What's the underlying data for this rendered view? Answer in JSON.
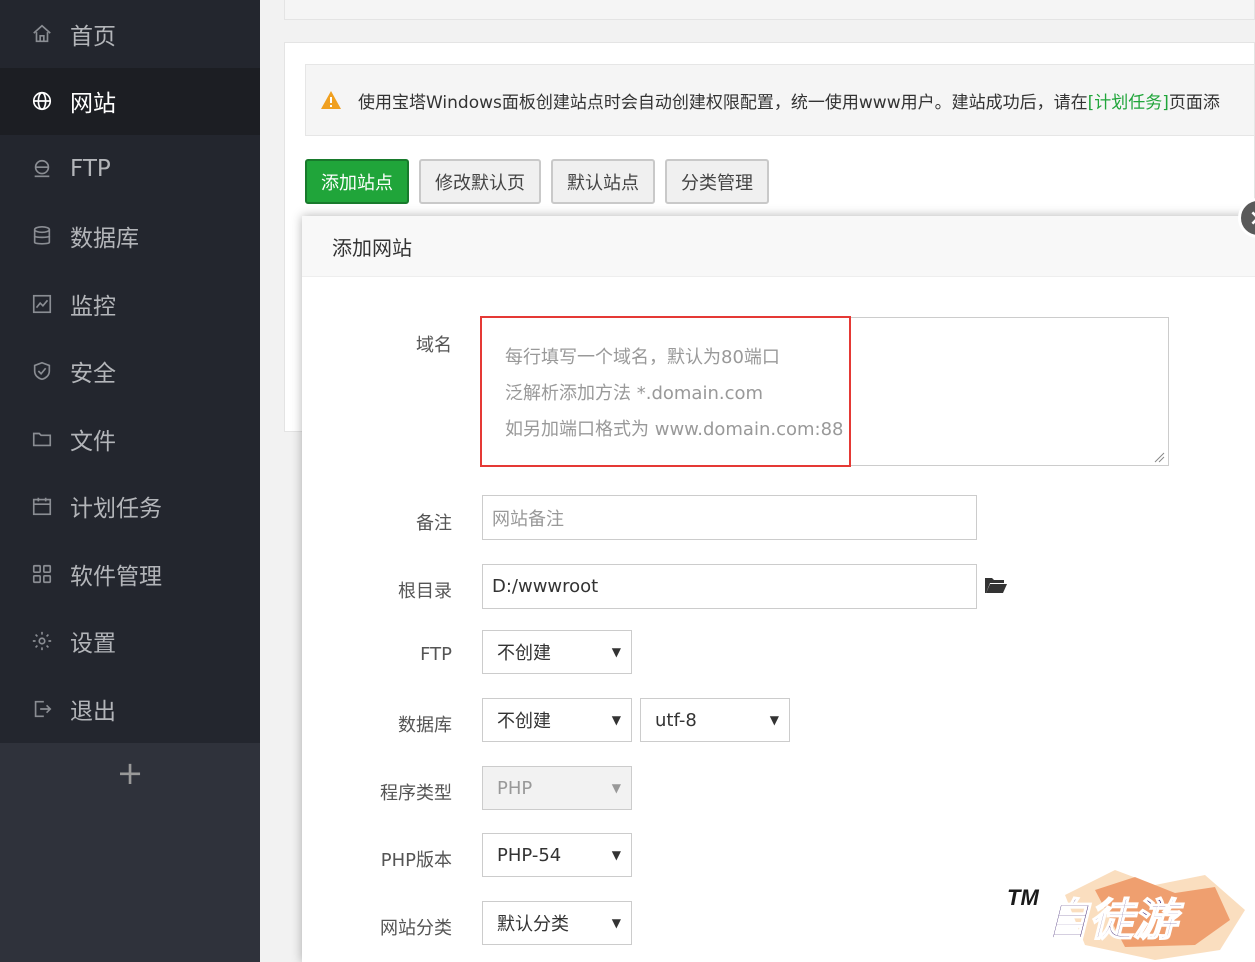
{
  "sidebar": {
    "items": [
      {
        "label": "首页",
        "icon": "home-icon"
      },
      {
        "label": "网站",
        "icon": "globe-icon",
        "active": true
      },
      {
        "label": "FTP",
        "icon": "ftp-icon"
      },
      {
        "label": "数据库",
        "icon": "database-icon"
      },
      {
        "label": "监控",
        "icon": "monitor-icon"
      },
      {
        "label": "安全",
        "icon": "shield-icon"
      },
      {
        "label": "文件",
        "icon": "folder-icon"
      },
      {
        "label": "计划任务",
        "icon": "calendar-icon"
      },
      {
        "label": "软件管理",
        "icon": "grid-icon"
      },
      {
        "label": "设置",
        "icon": "gear-icon"
      },
      {
        "label": "退出",
        "icon": "logout-icon"
      }
    ],
    "add_label": "+"
  },
  "alert": {
    "text_before": "使用宝塔Windows面板创建站点时会自动创建权限配置，统一使用www用户。建站成功后，请在",
    "link": "[计划任务]",
    "text_after": "页面添"
  },
  "toolbar": {
    "add_site": "添加站点",
    "edit_default_page": "修改默认页",
    "default_site": "默认站点",
    "category_manage": "分类管理"
  },
  "modal": {
    "title": "添加网站",
    "close": "×",
    "domain": {
      "label": "域名",
      "placeholder_lines": [
        "每行填写一个域名，默认为80端口",
        "泛解析添加方法 *.domain.com",
        "如另加端口格式为 www.domain.com:88"
      ]
    },
    "remark": {
      "label": "备注",
      "placeholder": "网站备注"
    },
    "root": {
      "label": "根目录",
      "value": "D:/wwwroot"
    },
    "ftp": {
      "label": "FTP",
      "value": "不创建"
    },
    "database": {
      "label": "数据库",
      "value": "不创建",
      "charset": "utf-8"
    },
    "program_type": {
      "label": "程序类型",
      "value": "PHP"
    },
    "php_version": {
      "label": "PHP版本",
      "value": "PHP-54"
    },
    "category": {
      "label": "网站分类",
      "value": "默认分类"
    }
  },
  "watermark": {
    "text": "TM 自徒游"
  },
  "colors": {
    "accent": "#20a53a",
    "sidebar": "#2f323b",
    "highlight": "#e53935"
  }
}
